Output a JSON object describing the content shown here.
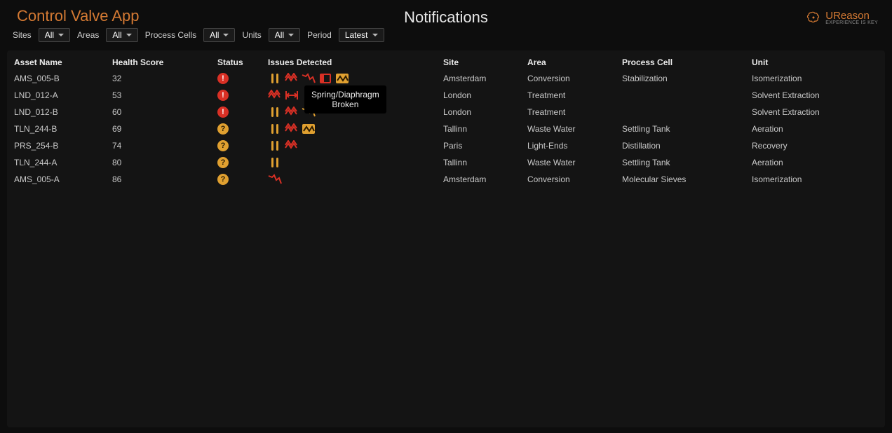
{
  "colors": {
    "accent": "#d57a33",
    "red": "#d93025",
    "orange": "#e0a030"
  },
  "header": {
    "app_title": "Control Valve App",
    "center_title": "Notifications",
    "brand_name": "UReason",
    "brand_sub": "EXPERIENCE IS KEY"
  },
  "filters": {
    "sites_label": "Sites",
    "sites_value": "All",
    "areas_label": "Areas",
    "areas_value": "All",
    "cells_label": "Process Cells",
    "cells_value": "All",
    "units_label": "Units",
    "units_value": "All",
    "period_label": "Period",
    "period_value": "Latest"
  },
  "table": {
    "headers": {
      "asset": "Asset Name",
      "health": "Health Score",
      "status": "Status",
      "issues": "Issues Detected",
      "site": "Site",
      "area": "Area",
      "cell": "Process Cell",
      "unit": "Unit"
    },
    "rows": [
      {
        "asset": "AMS_005-B",
        "health": "32",
        "status": "red",
        "issues": [
          "ob",
          "zr",
          "dr",
          "sr",
          "zo"
        ],
        "site": "Amsterdam",
        "area": "Conversion",
        "cell": "Stabilization",
        "unit": "Isomerization"
      },
      {
        "asset": "LND_012-A",
        "health": "53",
        "status": "red",
        "issues": [
          "zr",
          "spr"
        ],
        "site": "London",
        "area": "Treatment",
        "cell": "",
        "unit": "Solvent Extraction"
      },
      {
        "asset": "LND_012-B",
        "health": "60",
        "status": "red",
        "issues": [
          "ob",
          "zr",
          "do"
        ],
        "site": "London",
        "area": "Treatment",
        "cell": "",
        "unit": "Solvent Extraction"
      },
      {
        "asset": "TLN_244-B",
        "health": "69",
        "status": "orange",
        "issues": [
          "ob",
          "zr",
          "zo"
        ],
        "site": "Tallinn",
        "area": "Waste Water",
        "cell": "Settling Tank",
        "unit": "Aeration"
      },
      {
        "asset": "PRS_254-B",
        "health": "74",
        "status": "orange",
        "issues": [
          "ob",
          "zr"
        ],
        "site": "Paris",
        "area": "Light-Ends",
        "cell": "Distillation",
        "unit": "Recovery"
      },
      {
        "asset": "TLN_244-A",
        "health": "80",
        "status": "orange",
        "issues": [
          "ob"
        ],
        "site": "Tallinn",
        "area": "Waste Water",
        "cell": "Settling Tank",
        "unit": "Aeration"
      },
      {
        "asset": "AMS_005-A",
        "health": "86",
        "status": "orange",
        "issues": [
          "dr"
        ],
        "site": "Amsterdam",
        "area": "Conversion",
        "cell": "Molecular Sieves",
        "unit": "Isomerization"
      }
    ]
  },
  "tooltip": {
    "visible_on_row": 1,
    "text": "Spring/Diaphragm Broken"
  },
  "icon_legend": {
    "ob": "oscillation-bars-icon",
    "zr": "zigzag-red-icon",
    "dr": "drift-down-red-icon",
    "sr": "stuck-red-icon",
    "zo": "zigzag-orange-icon",
    "spr": "spring-broken-icon",
    "do": "drift-down-orange-icon"
  }
}
